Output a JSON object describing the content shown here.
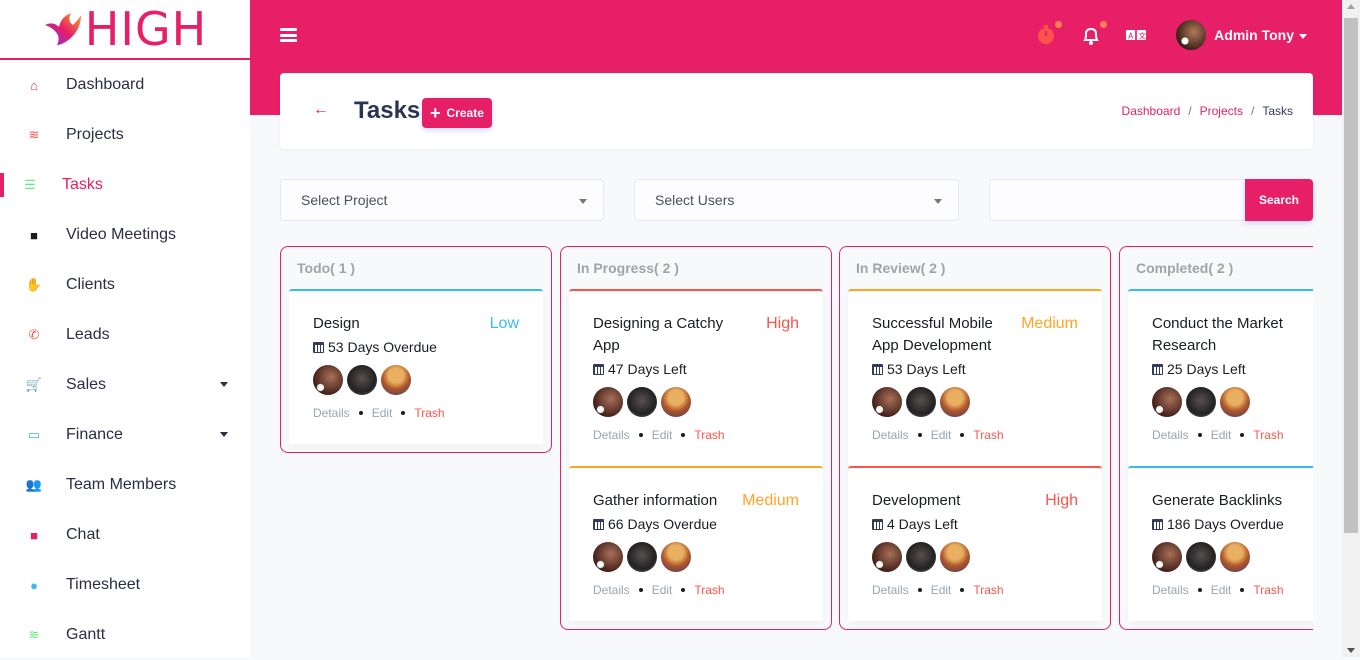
{
  "brand": {
    "name": "HIGH",
    "color": "#e61f66"
  },
  "sidebar": {
    "items": [
      {
        "label": "Dashboard",
        "icon": "home-icon",
        "color": "#e61f66",
        "glyph": "⌂"
      },
      {
        "label": "Projects",
        "icon": "layers-icon",
        "color": "#fc544b",
        "glyph": "≋"
      },
      {
        "label": "Tasks",
        "icon": "tasks-list-icon",
        "color": "#63ed7a",
        "glyph": "☰",
        "active": true
      },
      {
        "label": "Video Meetings",
        "icon": "video-camera-icon",
        "color": "#191d21",
        "glyph": "■"
      },
      {
        "label": "Clients",
        "icon": "handshake-icon",
        "color": "#ffa426",
        "glyph": "✋"
      },
      {
        "label": "Leads",
        "icon": "phone-icon",
        "color": "#fc544b",
        "glyph": "✆"
      },
      {
        "label": "Sales",
        "icon": "cart-icon",
        "color": "#63ed7a",
        "glyph": "🛒",
        "has_submenu": true
      },
      {
        "label": "Finance",
        "icon": "credit-card-icon",
        "color": "#3abaf4",
        "glyph": "▭",
        "has_submenu": true
      },
      {
        "label": "Team Members",
        "icon": "users-icon",
        "color": "#191d21",
        "glyph": "👥"
      },
      {
        "label": "Chat",
        "icon": "chat-icon",
        "color": "#e61f66",
        "glyph": "■"
      },
      {
        "label": "Timesheet",
        "icon": "clock-icon",
        "color": "#3abaf4",
        "glyph": "●"
      },
      {
        "label": "Gantt",
        "icon": "layers-icon",
        "color": "#63ed7a",
        "glyph": "≋"
      }
    ]
  },
  "topbar": {
    "user_name": "Admin Tony",
    "icons": [
      "stopwatch-icon",
      "bell-icon",
      "language-icon"
    ]
  },
  "page": {
    "title": "Tasks",
    "create_label": "Create",
    "breadcrumb": [
      "Dashboard",
      "Projects",
      "Tasks"
    ]
  },
  "filters": {
    "project_placeholder": "Select Project",
    "users_placeholder": "Select Users",
    "search_value": "",
    "search_label": "Search"
  },
  "priority_colors": {
    "Low": "#3abaf4",
    "Medium": "#ffa426",
    "High": "#fc544b"
  },
  "columns": [
    {
      "title": "Todo( 1 )",
      "tasks": [
        {
          "title": "Design",
          "priority": "Low",
          "due": "53 Days Overdue",
          "accent": "#3abaf4"
        }
      ]
    },
    {
      "title": "In Progress( 2 )",
      "tasks": [
        {
          "title": "Designing a Catchy App",
          "priority": "High",
          "due": "47 Days Left",
          "accent": "#fc544b"
        },
        {
          "title": "Gather information",
          "priority": "Medium",
          "due": "66 Days Overdue",
          "accent": "#ffa426"
        }
      ]
    },
    {
      "title": "In Review( 2 )",
      "tasks": [
        {
          "title": "Successful Mobile App Development",
          "priority": "Medium",
          "due": "53 Days Left",
          "accent": "#ffa426"
        },
        {
          "title": "Development",
          "priority": "High",
          "due": "4 Days Left",
          "accent": "#fc544b"
        }
      ]
    },
    {
      "title": "Completed( 2 )",
      "tasks": [
        {
          "title": "Conduct the Market Research",
          "priority": "",
          "due": "25 Days Left",
          "accent": "#3abaf4"
        },
        {
          "title": "Generate Backlinks",
          "priority": "",
          "due": "186 Days Overdue",
          "accent": "#3abaf4"
        }
      ]
    }
  ],
  "card_actions": {
    "details": "Details",
    "edit": "Edit",
    "trash": "Trash"
  }
}
